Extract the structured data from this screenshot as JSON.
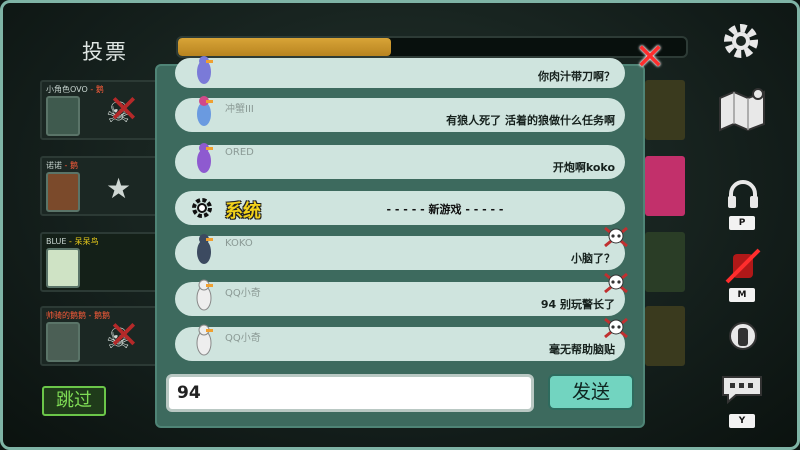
{
  "vote_panel": {
    "title": "投票",
    "timer_progress": 0.42,
    "skip_label": "跳过",
    "players": [
      {
        "name": "小角色OVO",
        "sub": "- 鹅"
      },
      {
        "name": "诺诺",
        "sub": "- 鹅"
      },
      {
        "name": "BLUE",
        "sub": "- 呆呆鸟"
      },
      {
        "name": "帅骑的鹅鹅",
        "sub": "- 鹅鹅"
      }
    ]
  },
  "chat": {
    "messages": [
      {
        "name": "",
        "text": "你肉汁带刀啊？"
      },
      {
        "name": "冲蟹III",
        "text": "有狼人死了 活着的狼做什么任务啊"
      },
      {
        "name": "ORED",
        "text": "开炮啊koko"
      },
      {
        "name": "KOKO",
        "text": "小脑了？"
      },
      {
        "name": "QQ小奇",
        "text": "94 别玩警长了"
      },
      {
        "name": "QQ小奇",
        "text": "毫无帮助脑贴"
      }
    ],
    "system": {
      "label": "系统",
      "notice": "- - - - - 新游戏 - - - - -"
    },
    "input_value": "94",
    "send_label": "发送"
  },
  "sidebar": {
    "items": [
      {
        "icon": "gear-icon"
      },
      {
        "icon": "map-icon"
      },
      {
        "icon": "headphones-icon",
        "key": "P"
      },
      {
        "icon": "mute-icon",
        "key": "M"
      },
      {
        "icon": "hand-icon"
      },
      {
        "icon": "chat-icon",
        "key": "Y"
      }
    ]
  },
  "colors": {
    "accent_teal": "#72d4c0",
    "timer_gold": "#d8a437",
    "danger": "#ff2d2d",
    "system_yellow": "#f2d21a"
  }
}
